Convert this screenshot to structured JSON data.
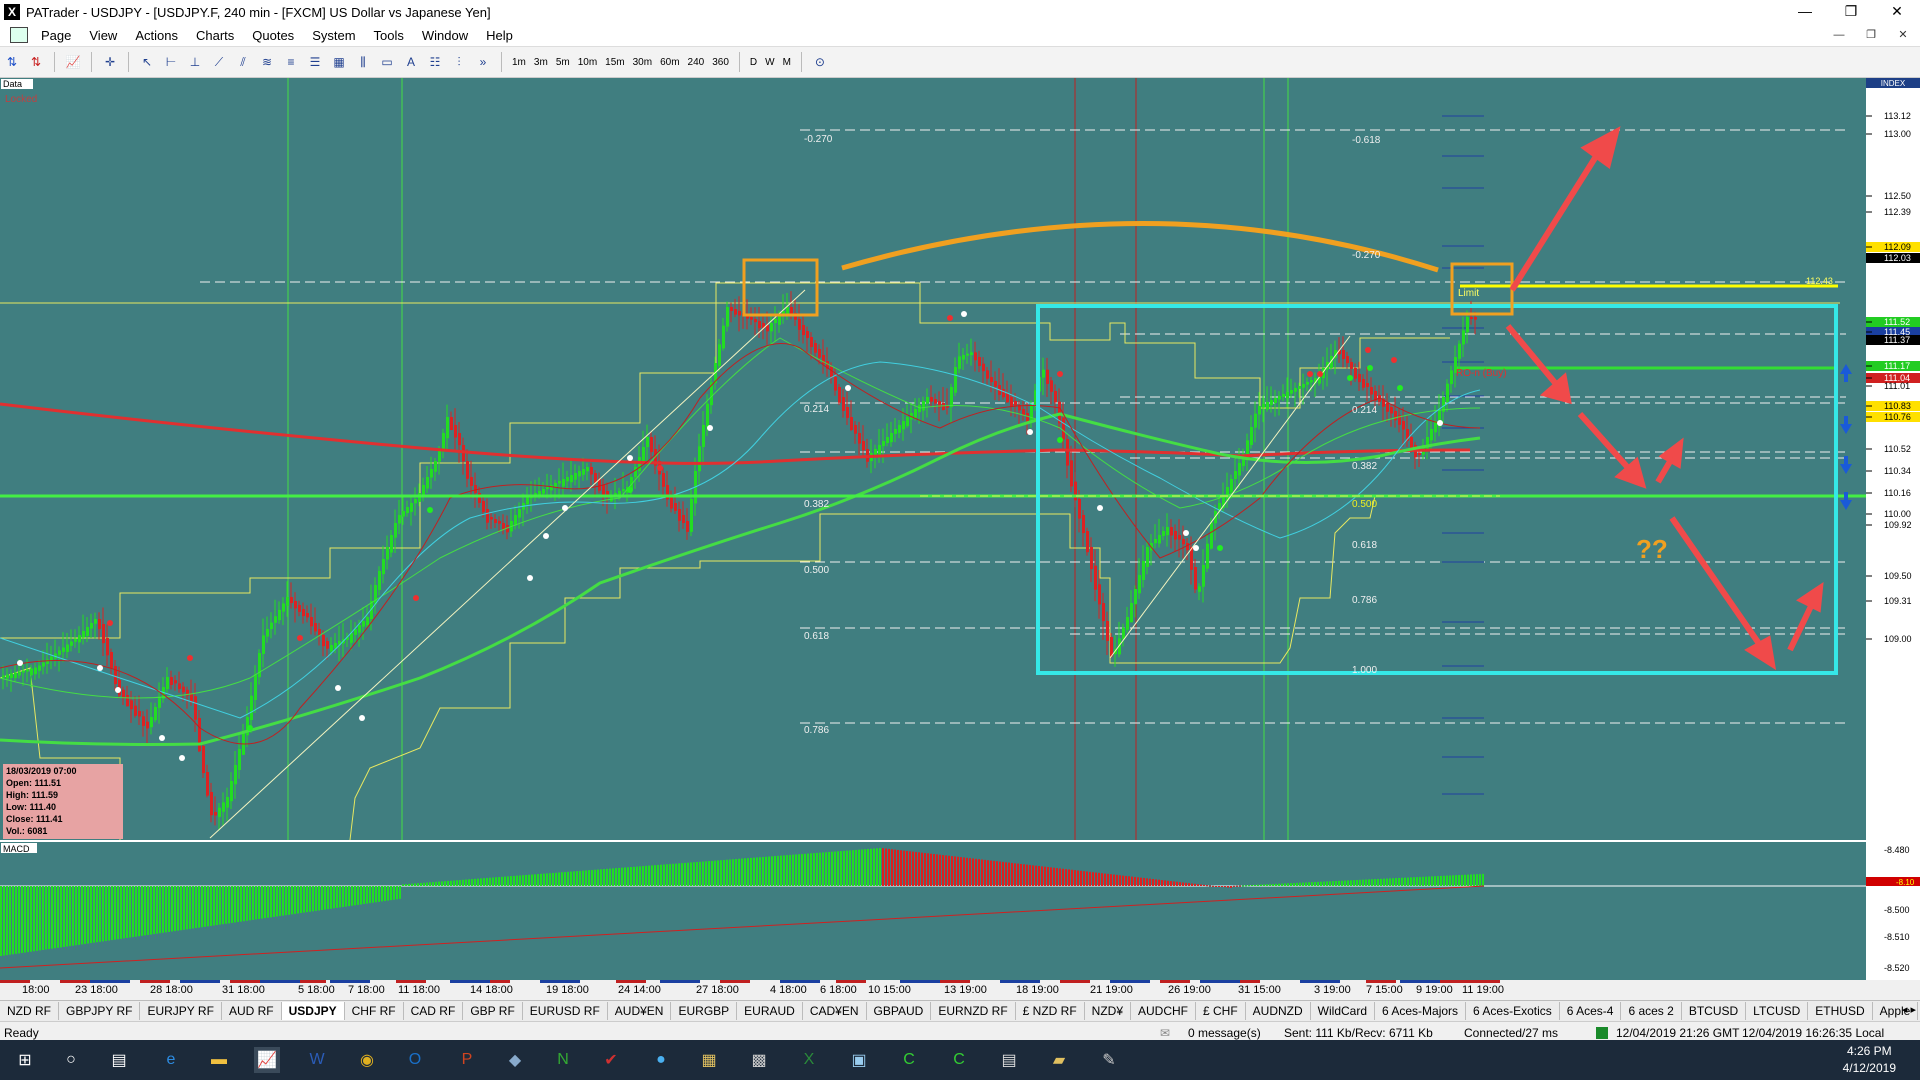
{
  "window": {
    "title": "PATrader - USDJPY - [USDJPY.F, 240 min - [FXCM] US Dollar vs Japanese Yen]",
    "app_icon": "X"
  },
  "menu": [
    "Page",
    "View",
    "Actions",
    "Charts",
    "Quotes",
    "System",
    "Tools",
    "Window",
    "Help"
  ],
  "timeframes": [
    "1m",
    "3m",
    "5m",
    "10m",
    "15m",
    "30m",
    "60m",
    "240",
    "360",
    "D",
    "W",
    "M"
  ],
  "chart": {
    "symbol_label": "Data",
    "locked_label": "Locked",
    "index_label": "INDEX",
    "macd_label": "MACD",
    "price_scale": [
      "113.12",
      "113.00",
      "112.50",
      "112.39",
      "112.09",
      "112.03",
      "111.52",
      "111.45",
      "111.37",
      "111.17",
      "111.04",
      "111.01",
      "110.83",
      "110.76",
      "110.52",
      "110.34",
      "110.16",
      "110.00",
      "109.92",
      "109.50",
      "109.31",
      "109.00"
    ],
    "fib_left": [
      "-0.270",
      "0.214",
      "0.382",
      "0.500",
      "0.618",
      "0.786"
    ],
    "fib_right": [
      "-0.618",
      "-0.270",
      "0.214",
      "0.382",
      "0.500",
      "0.618",
      "0.786",
      "1.000"
    ],
    "order_labels": {
      "limit": "Limit",
      "buy": "RO-n (Buy)",
      "level": "112.43"
    },
    "question": "??",
    "macd_scale": [
      "-8.480",
      "-8.500",
      "-8.510",
      "-8.520"
    ],
    "macd_value": "-8.10",
    "time_axis": [
      "18:00",
      "23 18:00",
      "28 18:00",
      "31 18:00",
      "5 18:00",
      "7 18:00",
      "11 18:00",
      "14 18:00",
      "19 18:00",
      "24 14:00",
      "27 18:00",
      "4 18:00",
      "6 18:00",
      "10 15:00",
      "13 19:00",
      "18 19:00",
      "21 19:00",
      "26 19:00",
      "31 15:00",
      "3 19:00",
      "7 15:00",
      "9 19:00",
      "11 19:00"
    ],
    "ohlc": {
      "date": "18/03/2019 07:00",
      "open": "Open: 111.51",
      "high": "High: 111.59",
      "low": "Low: 111.40",
      "close": "Close: 111.41",
      "vol": "Vol.: 6081"
    },
    "colors": {
      "bg": "#407e80",
      "up": "#22dd22",
      "down": "#dd2222",
      "ma_red": "#e03030",
      "ma_green": "#44dd44",
      "envelope": "#e8e860",
      "box": "#35e8e8",
      "arrow": "#f04a4a",
      "arc": "#f0a020"
    }
  },
  "tabs": [
    "NZD RF",
    "GBPJPY RF",
    "EURJPY RF",
    "AUD RF",
    "USDJPY",
    "CHF RF",
    "CAD RF",
    "GBP RF",
    "EURUSD RF",
    "AUD¥EN",
    "EURGBP",
    "EURAUD",
    "CAD¥EN",
    "GBPAUD",
    "EURNZD RF",
    "£ NZD RF",
    "NZD¥",
    "AUDCHF",
    "£ CHF",
    "AUDNZD",
    "WildCard",
    "6 Aces-Majors",
    "6 Aces-Exotics",
    "6 Aces-4",
    "6 aces 2",
    "BTCUSD",
    "LTCUSD",
    "ETHUSD",
    "Apple"
  ],
  "active_tab": "USDJPY",
  "status": {
    "ready": "Ready",
    "messages": "0 message(s)",
    "sent": "Sent: 111 Kb/Recv: 6711 Kb",
    "connected": "Connected/27 ms",
    "gmt": "12/04/2019 21:26 GMT",
    "local": "12/04/2019 16:26:35 Local"
  },
  "clock": {
    "time": "4:26 PM",
    "date": "4/12/2019"
  }
}
